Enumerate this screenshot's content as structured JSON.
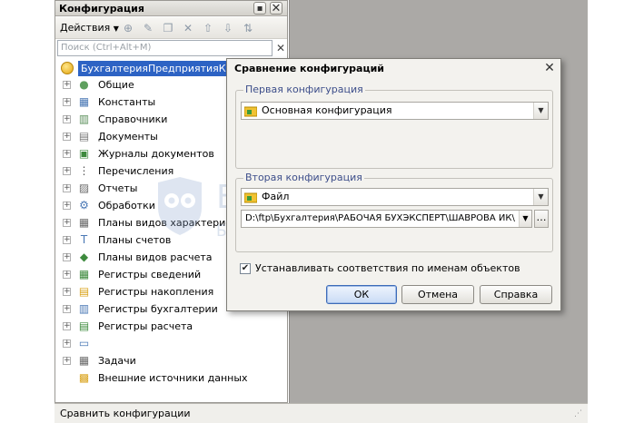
{
  "panel": {
    "title": "Конфигурация",
    "actions_label": "Действия",
    "search_placeholder": "Поиск (Ctrl+Alt+M)",
    "root": "БухгалтерияПредприятияКОРП",
    "items": [
      {
        "label": "Общие",
        "icon": "general-icon"
      },
      {
        "label": "Константы",
        "icon": "constants-icon"
      },
      {
        "label": "Справочники",
        "icon": "catalogs-icon"
      },
      {
        "label": "Документы",
        "icon": "documents-icon"
      },
      {
        "label": "Журналы документов",
        "icon": "document-journals-icon"
      },
      {
        "label": "Перечисления",
        "icon": "enumerations-icon"
      },
      {
        "label": "Отчеты",
        "icon": "reports-icon"
      },
      {
        "label": "Обработки",
        "icon": "data-processors-icon"
      },
      {
        "label": "Планы видов характеристик",
        "icon": "chart-of-characteristic-types-icon"
      },
      {
        "label": "Планы счетов",
        "icon": "chart-of-accounts-icon"
      },
      {
        "label": "Планы видов расчета",
        "icon": "chart-of-calculation-types-icon"
      },
      {
        "label": "Регистры сведений",
        "icon": "information-registers-icon"
      },
      {
        "label": "Регистры накопления",
        "icon": "accumulation-registers-icon"
      },
      {
        "label": "Регистры бухгалтерии",
        "icon": "accounting-registers-icon"
      },
      {
        "label": "Регистры расчета",
        "icon": "calculation-registers-icon"
      },
      {
        "label": "",
        "icon": "business-processes-icon"
      },
      {
        "label": "Задачи",
        "icon": "tasks-icon"
      },
      {
        "label": "Внешние источники данных",
        "icon": "external-data-sources-icon"
      }
    ]
  },
  "status_bar": {
    "text": "Сравнить конфигурации"
  },
  "dialog": {
    "title": "Сравнение конфигураций",
    "first_group": {
      "title": "Первая конфигурация",
      "value": "Основная конфигурация"
    },
    "second_group": {
      "title": "Вторая конфигурация",
      "value": "Файл",
      "path": "D:\\ftp\\Бухгалтерия\\РАБОЧАЯ БУХЭКСПЕРТ\\ШАВРОВА ИК\\"
    },
    "checkbox_label": "Устанавливать соответствия по именам объектов",
    "checkbox_checked": true,
    "buttons": {
      "ok": "ОК",
      "cancel": "Отмена",
      "help": "Справка"
    }
  },
  "watermark": {
    "brand": "БухЭксперт",
    "tagline": "База ответов по учёту в 1С"
  },
  "colors": {
    "selection": "#2d63c4",
    "group_title": "#3d4e8a"
  }
}
